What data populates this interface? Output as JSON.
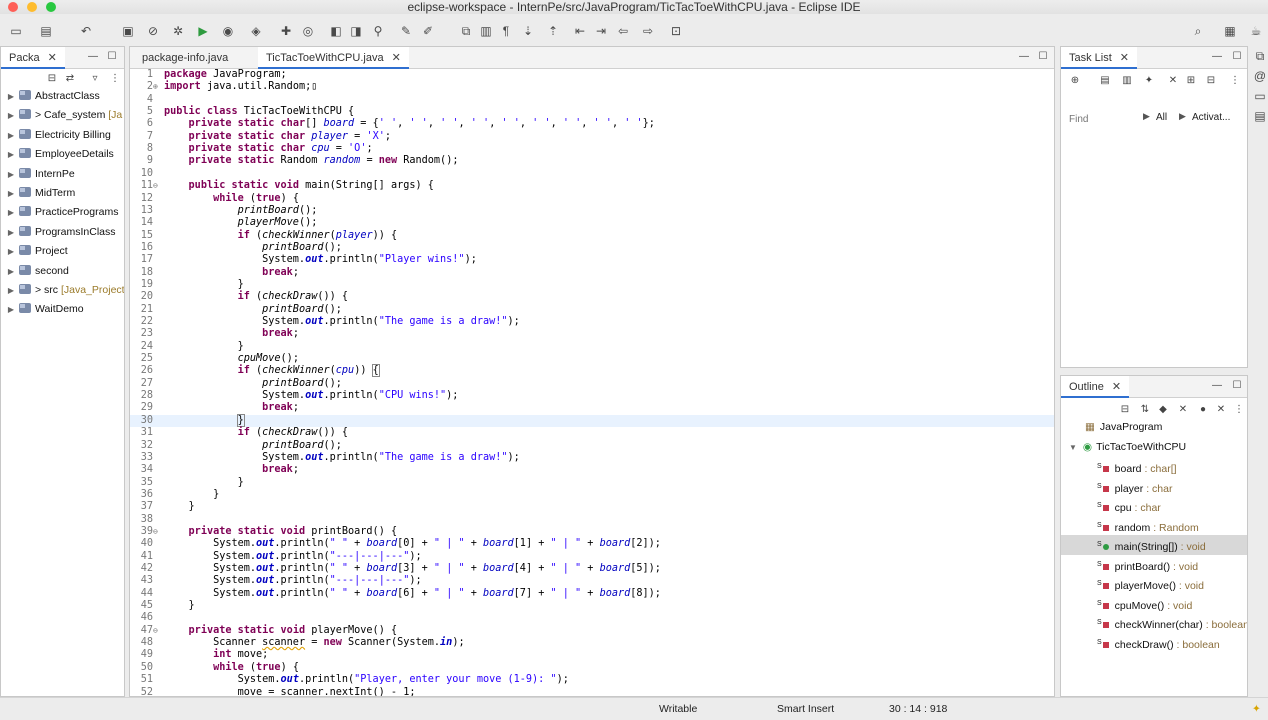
{
  "window": {
    "title": "eclipse-workspace - InternPe/src/JavaProgram/TicTacToeWithCPU.java - Eclipse IDE"
  },
  "package_explorer": {
    "tab": "Packa",
    "items": [
      {
        "label": "AbstractClass",
        "deco": ""
      },
      {
        "label": "> Cafe_system",
        "deco": " [Ja"
      },
      {
        "label": "Electricity Billing",
        "deco": ""
      },
      {
        "label": "EmployeeDetails",
        "deco": ""
      },
      {
        "label": "InternPe",
        "deco": ""
      },
      {
        "label": "MidTerm",
        "deco": ""
      },
      {
        "label": "PracticePrograms",
        "deco": ""
      },
      {
        "label": "ProgramsInClass",
        "deco": ""
      },
      {
        "label": "Project",
        "deco": ""
      },
      {
        "label": "second",
        "deco": ""
      },
      {
        "label": "> src",
        "deco": " [Java_Project"
      },
      {
        "label": "WaitDemo",
        "deco": ""
      }
    ]
  },
  "editor": {
    "tabs": [
      {
        "label": "package-info.java"
      },
      {
        "label": "TicTacToeWithCPU.java"
      }
    ],
    "lines": [
      {
        "n": "1",
        "fold": "",
        "html": "<span class=\"kw\">package</span> JavaProgram;"
      },
      {
        "n": "2",
        "fold": "⊕",
        "html": "<span class=\"kw\">import</span> java.util.Random;▯"
      },
      {
        "n": "4",
        "fold": "",
        "html": ""
      },
      {
        "n": "5",
        "fold": "",
        "html": "<span class=\"kw\">public class</span> TicTacToeWithCPU {"
      },
      {
        "n": "6",
        "fold": "",
        "html": "    <span class=\"kw\">private static char</span>[] <span class=\"fld\">board</span> = {<span class=\"str\">' '</span>, <span class=\"str\">' '</span>, <span class=\"str\">' '</span>, <span class=\"str\">' '</span>, <span class=\"str\">' '</span>, <span class=\"str\">' '</span>, <span class=\"str\">' '</span>, <span class=\"str\">' '</span>, <span class=\"str\">' '</span>};"
      },
      {
        "n": "7",
        "fold": "",
        "html": "    <span class=\"kw\">private static char</span> <span class=\"fld\">player</span> = <span class=\"str\">'X'</span>;"
      },
      {
        "n": "8",
        "fold": "",
        "html": "    <span class=\"kw\">private static char</span> <span class=\"fld\">cpu</span> = <span class=\"str\">'O'</span>;"
      },
      {
        "n": "9",
        "fold": "",
        "html": "    <span class=\"kw\">private static</span> Random <span class=\"fld\">random</span> = <span class=\"kw\">new</span> Random();"
      },
      {
        "n": "10",
        "fold": "",
        "html": ""
      },
      {
        "n": "11",
        "fold": "⊖",
        "html": "    <span class=\"kw\">public static void</span> main(String[] args) {"
      },
      {
        "n": "12",
        "fold": "",
        "html": "        <span class=\"kw\">while</span> (<span class=\"kw\">true</span>) {"
      },
      {
        "n": "13",
        "fold": "",
        "html": "            <span class=\"mth\">printBoard</span>();"
      },
      {
        "n": "14",
        "fold": "",
        "html": "            <span class=\"mth\">playerMove</span>();"
      },
      {
        "n": "15",
        "fold": "",
        "html": "            <span class=\"kw\">if</span> (<span class=\"mth\">checkWinner</span>(<span class=\"fld\">player</span>)) {"
      },
      {
        "n": "16",
        "fold": "",
        "html": "                <span class=\"mth\">printBoard</span>();"
      },
      {
        "n": "17",
        "fold": "",
        "html": "                System.<span class=\"sfld\">out</span>.println(<span class=\"str\">\"Player wins!\"</span>);"
      },
      {
        "n": "18",
        "fold": "",
        "html": "                <span class=\"kw\">break</span>;"
      },
      {
        "n": "19",
        "fold": "",
        "html": "            }"
      },
      {
        "n": "20",
        "fold": "",
        "html": "            <span class=\"kw\">if</span> (<span class=\"mth\">checkDraw</span>()) {"
      },
      {
        "n": "21",
        "fold": "",
        "html": "                <span class=\"mth\">printBoard</span>();"
      },
      {
        "n": "22",
        "fold": "",
        "html": "                System.<span class=\"sfld\">out</span>.println(<span class=\"str\">\"The game is a draw!\"</span>);"
      },
      {
        "n": "23",
        "fold": "",
        "html": "                <span class=\"kw\">break</span>;"
      },
      {
        "n": "24",
        "fold": "",
        "html": "            }"
      },
      {
        "n": "25",
        "fold": "",
        "html": "            <span class=\"mth\">cpuMove</span>();"
      },
      {
        "n": "26",
        "fold": "",
        "html": "            <span class=\"kw\">if</span> (<span class=\"mth\">checkWinner</span>(<span class=\"fld\">cpu</span>)) <span style=\"outline:1px solid #888\">{</span>"
      },
      {
        "n": "27",
        "fold": "",
        "html": "                <span class=\"mth\">printBoard</span>();"
      },
      {
        "n": "28",
        "fold": "",
        "html": "                System.<span class=\"sfld\">out</span>.println(<span class=\"str\">\"CPU wins!\"</span>);"
      },
      {
        "n": "29",
        "fold": "",
        "html": "                <span class=\"kw\">break</span>;"
      },
      {
        "n": "30",
        "fold": "",
        "html": "            <span style=\"outline:1px solid #888\">}</span>"
      },
      {
        "n": "31",
        "fold": "",
        "html": "            <span class=\"kw\">if</span> (<span class=\"mth\">checkDraw</span>()) {"
      },
      {
        "n": "32",
        "fold": "",
        "html": "                <span class=\"mth\">printBoard</span>();"
      },
      {
        "n": "33",
        "fold": "",
        "html": "                System.<span class=\"sfld\">out</span>.println(<span class=\"str\">\"The game is a draw!\"</span>);"
      },
      {
        "n": "34",
        "fold": "",
        "html": "                <span class=\"kw\">break</span>;"
      },
      {
        "n": "35",
        "fold": "",
        "html": "            }"
      },
      {
        "n": "36",
        "fold": "",
        "html": "        }"
      },
      {
        "n": "37",
        "fold": "",
        "html": "    }"
      },
      {
        "n": "38",
        "fold": "",
        "html": ""
      },
      {
        "n": "39",
        "fold": "⊖",
        "html": "    <span class=\"kw\">private static void</span> printBoard() {"
      },
      {
        "n": "40",
        "fold": "",
        "html": "        System.<span class=\"sfld\">out</span>.println(<span class=\"str\">\" \"</span> + <span class=\"fld\">board</span>[0] + <span class=\"str\">\" | \"</span> + <span class=\"fld\">board</span>[1] + <span class=\"str\">\" | \"</span> + <span class=\"fld\">board</span>[2]);"
      },
      {
        "n": "41",
        "fold": "",
        "html": "        System.<span class=\"sfld\">out</span>.println(<span class=\"str\">\"---|---|---\"</span>);"
      },
      {
        "n": "42",
        "fold": "",
        "html": "        System.<span class=\"sfld\">out</span>.println(<span class=\"str\">\" \"</span> + <span class=\"fld\">board</span>[3] + <span class=\"str\">\" | \"</span> + <span class=\"fld\">board</span>[4] + <span class=\"str\">\" | \"</span> + <span class=\"fld\">board</span>[5]);"
      },
      {
        "n": "43",
        "fold": "",
        "html": "        System.<span class=\"sfld\">out</span>.println(<span class=\"str\">\"---|---|---\"</span>);"
      },
      {
        "n": "44",
        "fold": "",
        "html": "        System.<span class=\"sfld\">out</span>.println(<span class=\"str\">\" \"</span> + <span class=\"fld\">board</span>[6] + <span class=\"str\">\" | \"</span> + <span class=\"fld\">board</span>[7] + <span class=\"str\">\" | \"</span> + <span class=\"fld\">board</span>[8]);"
      },
      {
        "n": "45",
        "fold": "",
        "html": "    }"
      },
      {
        "n": "46",
        "fold": "",
        "html": ""
      },
      {
        "n": "47",
        "fold": "⊖",
        "html": "    <span class=\"kw\">private static void</span> playerMove() {"
      },
      {
        "n": "48",
        "fold": "",
        "html": "        Scanner <span class=\"uline\">scanner</span> = <span class=\"kw\">new</span> Scanner(System.<span class=\"sfld\">in</span>);"
      },
      {
        "n": "49",
        "fold": "",
        "html": "        <span class=\"kw\">int</span> move;"
      },
      {
        "n": "50",
        "fold": "",
        "html": "        <span class=\"kw\">while</span> (<span class=\"kw\">true</span>) {"
      },
      {
        "n": "51",
        "fold": "",
        "html": "            System.<span class=\"sfld\">out</span>.println(<span class=\"str\">\"Player, enter your move (1-9): \"</span>);"
      },
      {
        "n": "52",
        "fold": "",
        "html": "            move = scanner.nextInt() - 1;"
      }
    ]
  },
  "task_list": {
    "tab": "Task List",
    "find_placeholder": "Find",
    "all_label": "All",
    "activate_label": "Activat..."
  },
  "outline": {
    "tab": "Outline",
    "items": [
      {
        "label": "JavaProgram",
        "type": "",
        "kind": "package",
        "indent": 1
      },
      {
        "label": "TicTacToeWithCPU",
        "type": "",
        "kind": "class",
        "indent": 1
      },
      {
        "label": "board",
        "type": " : char[]",
        "kind": "priv",
        "indent": 2
      },
      {
        "label": "player",
        "type": " : char",
        "kind": "priv",
        "indent": 2
      },
      {
        "label": "cpu",
        "type": " : char",
        "kind": "priv",
        "indent": 2
      },
      {
        "label": "random",
        "type": " : Random",
        "kind": "priv",
        "indent": 2
      },
      {
        "label": "main(String[])",
        "type": " : void",
        "kind": "pub",
        "indent": 2
      },
      {
        "label": "printBoard()",
        "type": " : void",
        "kind": "priv",
        "indent": 2
      },
      {
        "label": "playerMove()",
        "type": " : void",
        "kind": "priv",
        "indent": 2
      },
      {
        "label": "cpuMove()",
        "type": " : void",
        "kind": "priv",
        "indent": 2
      },
      {
        "label": "checkWinner(char)",
        "type": " : boolean",
        "kind": "priv",
        "indent": 2
      },
      {
        "label": "checkDraw()",
        "type": " : boolean",
        "kind": "priv",
        "indent": 2
      }
    ]
  },
  "status": {
    "writable": "Writable",
    "insert_mode": "Smart Insert",
    "position": "30 : 14 : 918"
  }
}
